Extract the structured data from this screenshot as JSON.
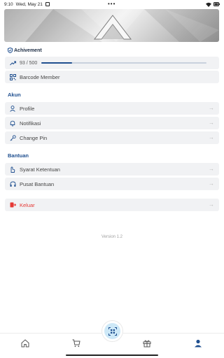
{
  "status": {
    "time": "9:10",
    "date": "Wed, May 21",
    "dots": "•••"
  },
  "achievement": {
    "title": "Achivement",
    "progress_text": "93 / 500",
    "progress_value": 93,
    "progress_max": 500
  },
  "barcode": {
    "label": "Barcode Member"
  },
  "account": {
    "section": "Akun",
    "items": [
      {
        "label": "Profile"
      },
      {
        "label": "Notifikasi"
      },
      {
        "label": "Change Pin"
      }
    ]
  },
  "help": {
    "section": "Bantuan",
    "items": [
      {
        "label": "Syarat Ketentuan"
      },
      {
        "label": "Pusat Bantuan"
      }
    ]
  },
  "logout": {
    "label": "Keluar"
  },
  "version": "Version 1.2",
  "colors": {
    "accent": "#1f4f8f",
    "danger": "#e53935",
    "row_bg": "#f1f2f4",
    "fab_bg": "#cde8f7"
  },
  "icons": {
    "progress": "trending-up-icon",
    "barcode": "qr-code-icon",
    "profile": "user-icon",
    "notifications": "bell-icon",
    "pin": "key-icon",
    "terms": "hand-icon",
    "support": "headset-icon",
    "logout": "logout-icon",
    "row_arrow": "arrow-right-icon",
    "nav_home": "home-icon",
    "nav_cart": "cart-icon",
    "nav_scan": "scan-icon",
    "nav_gift": "gift-icon",
    "nav_profile": "user-icon"
  }
}
